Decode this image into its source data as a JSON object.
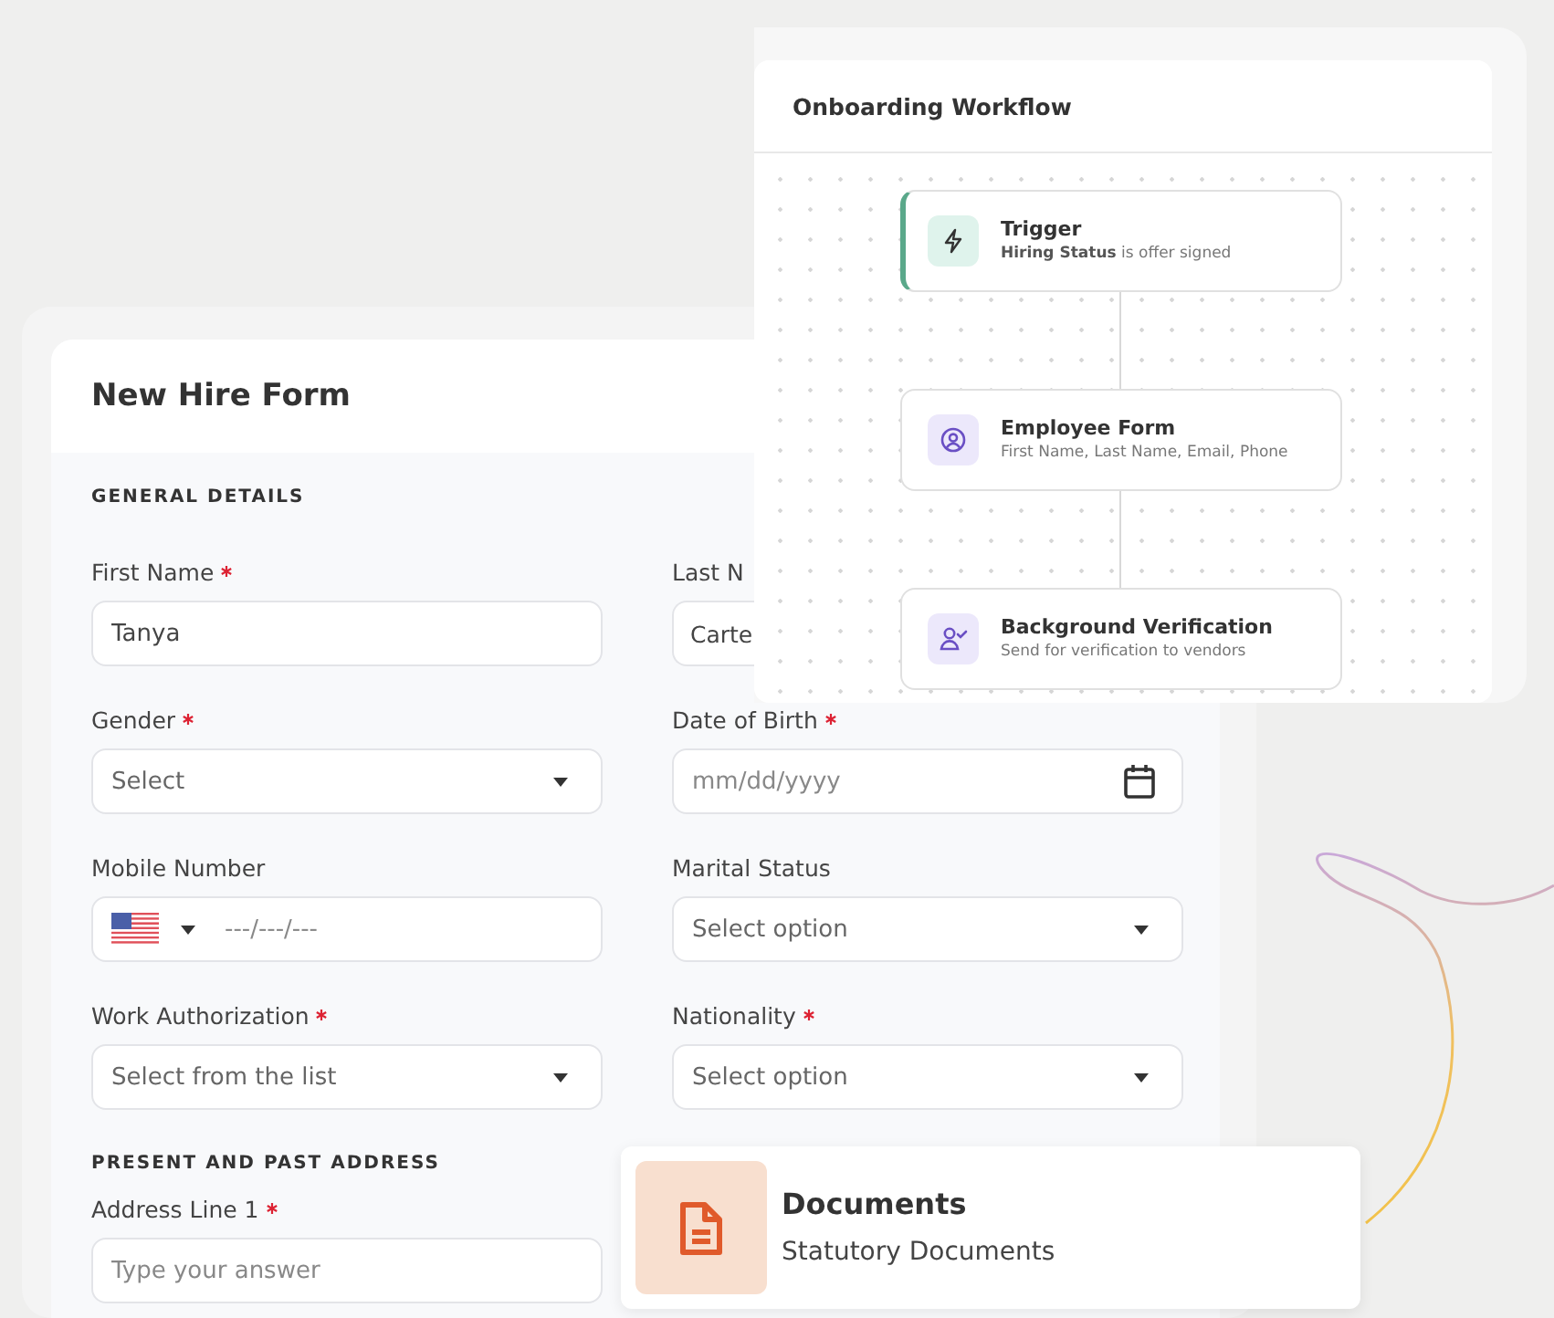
{
  "form": {
    "title": "New Hire Form",
    "sections": [
      {
        "heading": "GENERAL DETAILS",
        "fields": [
          {
            "kind": "text",
            "label": "First Name",
            "required": true,
            "value": "Tanya"
          },
          {
            "kind": "text",
            "label": "Last N",
            "required": false,
            "value": "Carte"
          },
          {
            "kind": "select",
            "label": "Gender",
            "required": true,
            "placeholder": "Select"
          },
          {
            "kind": "date",
            "label": "Date of Birth",
            "required": true,
            "placeholder": "mm/dd/yyyy"
          },
          {
            "kind": "phone",
            "label": "Mobile Number",
            "required": false,
            "placeholder": "---/---/---"
          },
          {
            "kind": "select",
            "label": "Marital Status",
            "required": false,
            "placeholder": "Select option"
          },
          {
            "kind": "select",
            "label": "Work Authorization",
            "required": true,
            "placeholder": "Select from the list"
          },
          {
            "kind": "select",
            "label": "Nationality",
            "required": true,
            "placeholder": "Select option"
          }
        ]
      },
      {
        "heading": "PRESENT AND PAST ADDRESS",
        "fields": [
          {
            "kind": "text",
            "label": "Address Line 1",
            "required": true,
            "placeholder": "Type your answer"
          }
        ]
      }
    ]
  },
  "workflow": {
    "title": "Onboarding Workflow",
    "steps": [
      {
        "kind": "trigger",
        "title": "Trigger",
        "detail": "**Hiring Status** is offer signed"
      },
      {
        "kind": "form",
        "title": "Employee Form",
        "detail": "First Name, Last Name, Email, Phone"
      },
      {
        "kind": "verification",
        "title": "Background Verification",
        "detail": "Send for verification to vendors"
      }
    ]
  },
  "documents": {
    "title": "Documents",
    "subtitle": "Statutory Documents"
  }
}
